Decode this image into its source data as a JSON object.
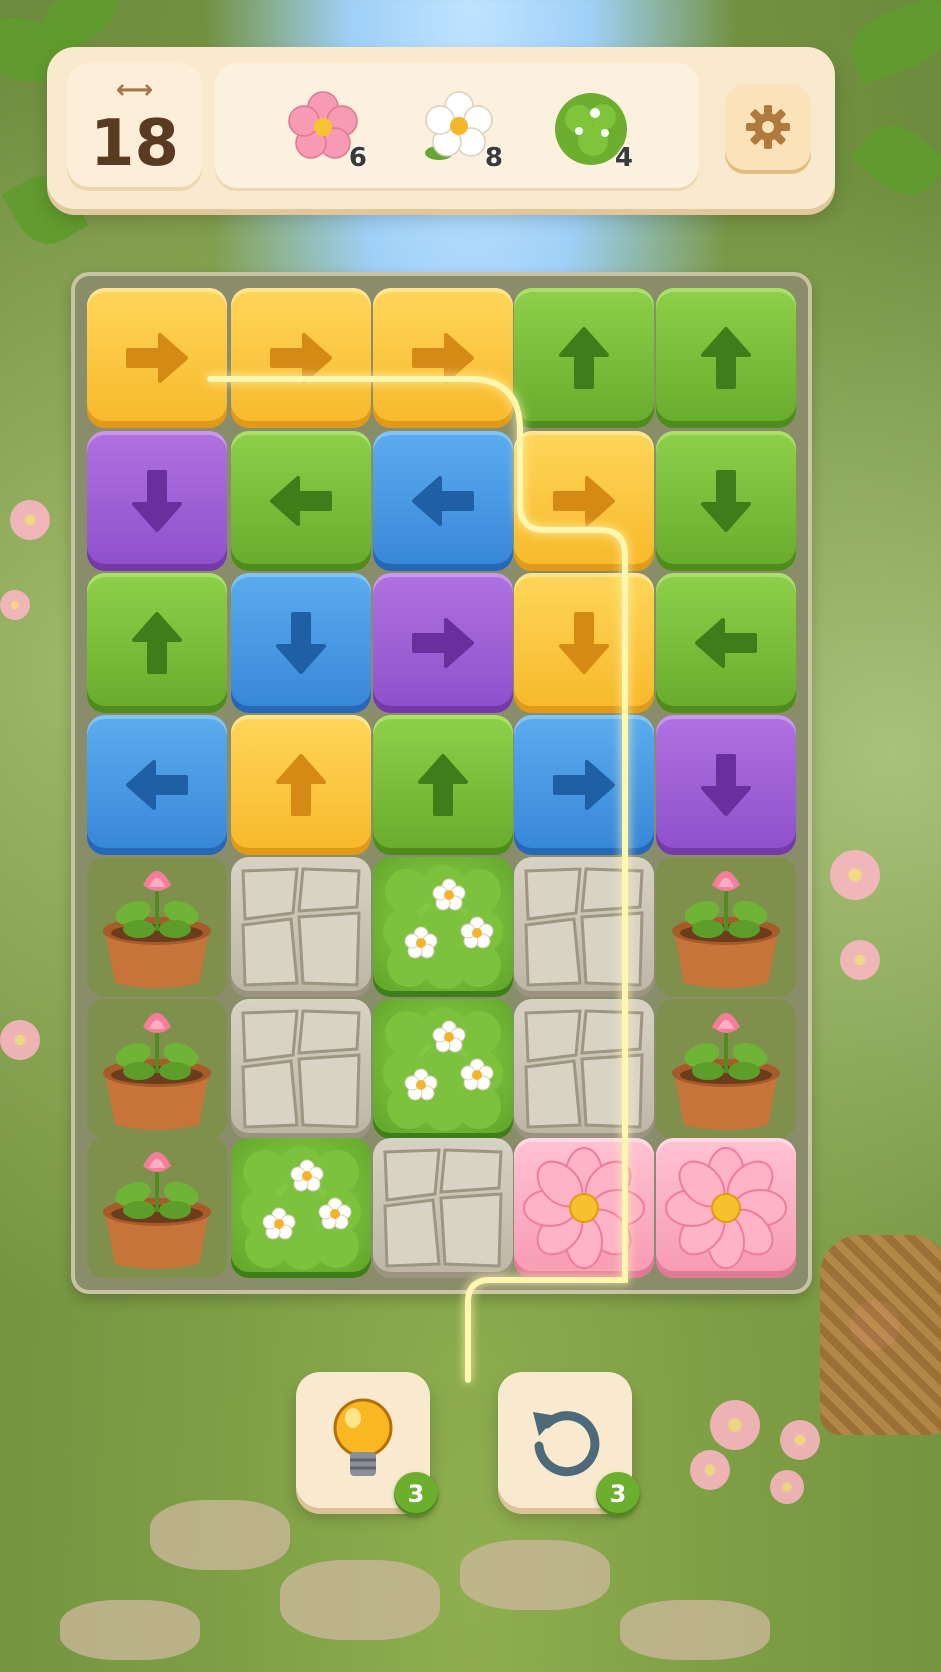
{
  "moves": {
    "count": "18",
    "icon": "arrows-horizontal-icon"
  },
  "goals": [
    {
      "name": "pink-flower",
      "count": "6"
    },
    {
      "name": "white-daisy",
      "count": "8"
    },
    {
      "name": "green-bush",
      "count": "4"
    }
  ],
  "settings": {
    "icon": "gear-icon"
  },
  "board": {
    "rows": [
      [
        {
          "type": "yellow",
          "dir": "right"
        },
        {
          "type": "yellow",
          "dir": "right"
        },
        {
          "type": "yellow",
          "dir": "right"
        },
        {
          "type": "green",
          "dir": "up"
        },
        {
          "type": "green",
          "dir": "up"
        }
      ],
      [
        {
          "type": "purple",
          "dir": "down"
        },
        {
          "type": "green",
          "dir": "left"
        },
        {
          "type": "blue",
          "dir": "left"
        },
        {
          "type": "yellow",
          "dir": "right"
        },
        {
          "type": "green",
          "dir": "down"
        }
      ],
      [
        {
          "type": "green",
          "dir": "up"
        },
        {
          "type": "blue",
          "dir": "down"
        },
        {
          "type": "purple",
          "dir": "right"
        },
        {
          "type": "yellow",
          "dir": "down"
        },
        {
          "type": "green",
          "dir": "left"
        }
      ],
      [
        {
          "type": "blue",
          "dir": "left"
        },
        {
          "type": "yellow",
          "dir": "up"
        },
        {
          "type": "green",
          "dir": "up"
        },
        {
          "type": "blue",
          "dir": "right"
        },
        {
          "type": "purple",
          "dir": "down"
        }
      ],
      [
        {
          "type": "pot"
        },
        {
          "type": "stone"
        },
        {
          "type": "bush"
        },
        {
          "type": "stone"
        },
        {
          "type": "pot"
        }
      ],
      [
        {
          "type": "pot"
        },
        {
          "type": "stone"
        },
        {
          "type": "bush"
        },
        {
          "type": "stone"
        },
        {
          "type": "pot"
        }
      ],
      [
        {
          "type": "pot"
        },
        {
          "type": "bush"
        },
        {
          "type": "stone"
        },
        {
          "type": "flower"
        },
        {
          "type": "flower"
        }
      ]
    ]
  },
  "boosters": [
    {
      "name": "hint",
      "icon": "lightbulb-icon",
      "count": "3"
    },
    {
      "name": "undo",
      "icon": "undo-icon",
      "count": "3"
    }
  ],
  "colors": {
    "yellow": "#f7b82a",
    "green": "#68ab2b",
    "blue": "#3686d7",
    "purple": "#8e4fcb",
    "pink": "#f79ab3",
    "badge": "#6cae2e",
    "panel": "#f8e9cf"
  }
}
